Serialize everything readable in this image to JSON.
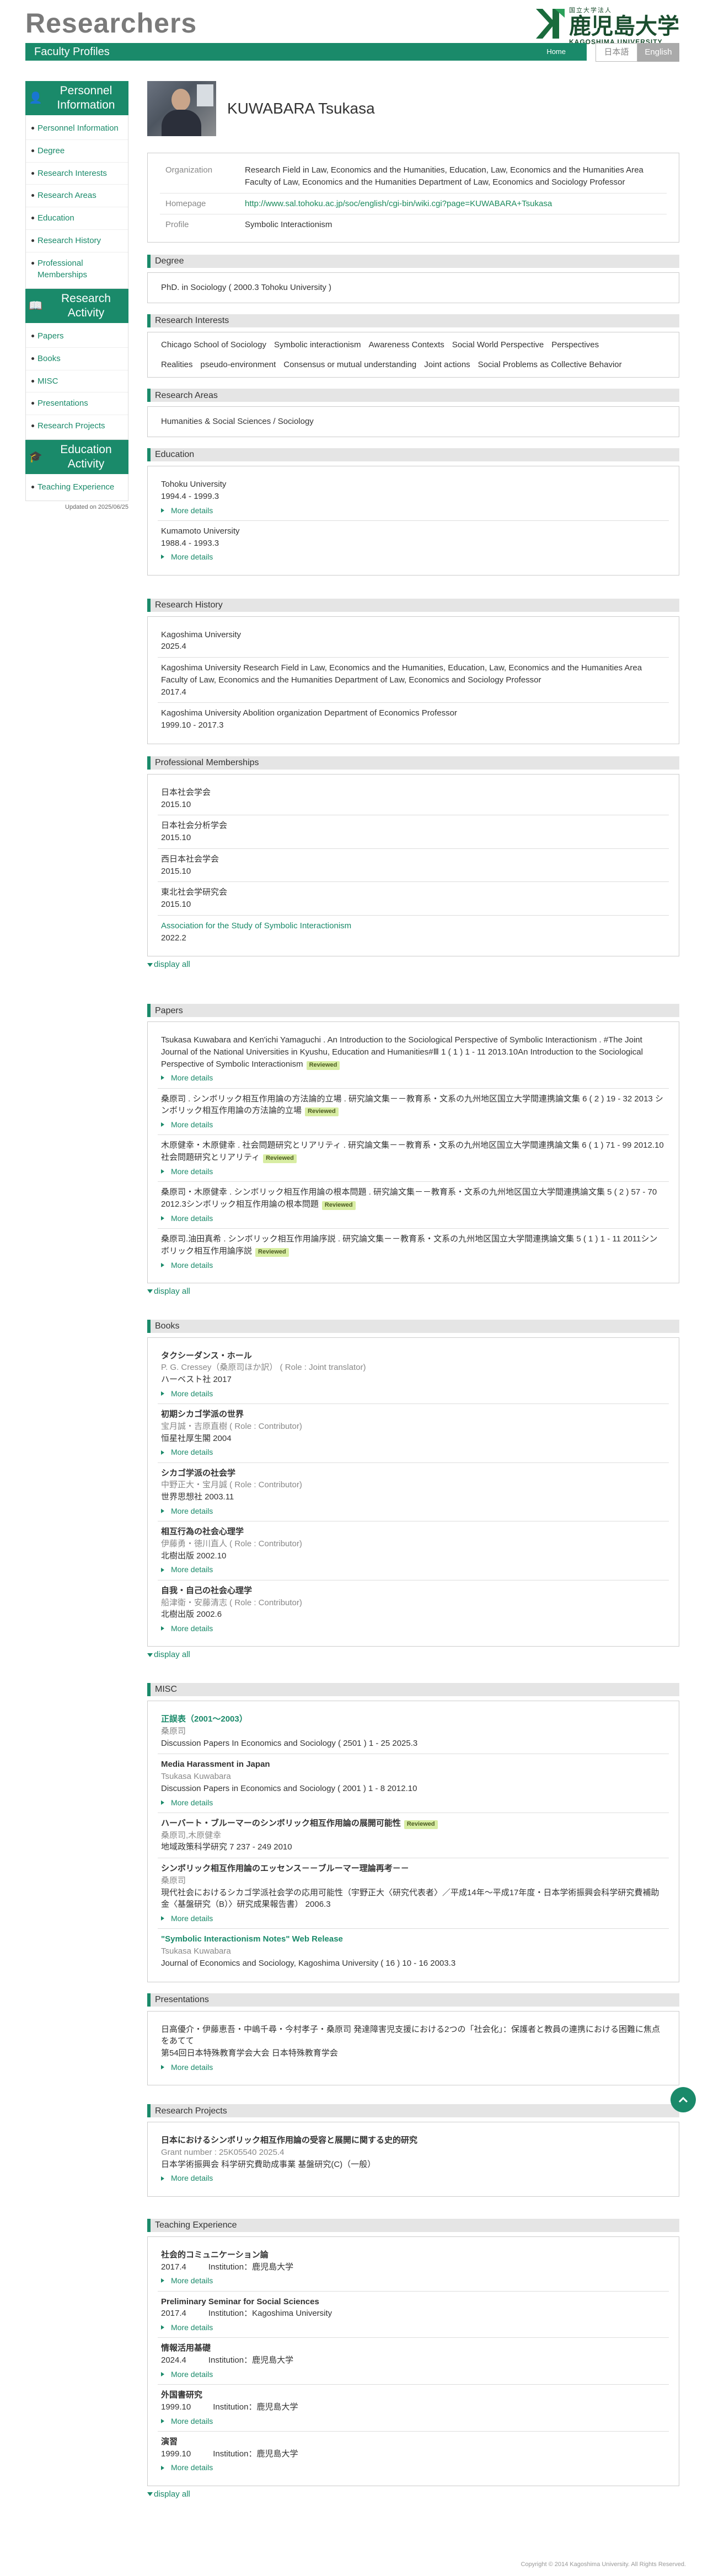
{
  "site": {
    "title": "Researchers",
    "logo_small": "国立大学法人",
    "logo_big": "鹿児島大学",
    "logo_en": "KAGOSHIMA UNIVERSITY"
  },
  "nav": {
    "page": "Faculty Profiles",
    "home": "Home",
    "lang_ja": "日本語",
    "lang_en": "English"
  },
  "sidebar": {
    "groups": [
      {
        "title": "Personnel Information",
        "items": [
          "Personnel Information",
          "Degree",
          "Research Interests",
          "Research Areas",
          "Education",
          "Research History",
          "Professional Memberships"
        ]
      },
      {
        "title": "Research Activity",
        "items": [
          "Papers",
          "Books",
          "MISC",
          "Presentations",
          "Research Projects"
        ]
      },
      {
        "title": "Education Activity",
        "items": [
          "Teaching Experience"
        ]
      }
    ],
    "updated": "Updated on 2025/06/25"
  },
  "profile": {
    "name": "KUWABARA Tsukasa",
    "organization_label": "Organization",
    "organization": "Research Field in Law, Economics and the Humanities, Education, Law, Economics and the Humanities Area Faculty of Law, Economics and the Humanities Department of Law, Economics and Sociology Professor",
    "homepage_label": "Homepage",
    "homepage": "http://www.sal.tohoku.ac.jp/soc/english/cgi-bin/wiki.cgi?page=KUWABARA+Tsukasa",
    "profile_label": "Profile",
    "profile": "Symbolic Interactionism"
  },
  "labels": {
    "more": "More details",
    "display_all": "display all",
    "reviewed": "Reviewed"
  },
  "degree": {
    "title": "Degree",
    "value": "PhD. in Sociology ( 2000.3   Tohoku University )"
  },
  "interests": {
    "title": "Research Interests",
    "items": [
      "Chicago School of Sociology",
      "Symbolic interactionism",
      "Awareness Contexts",
      "Social World Perspective",
      "Perspectives",
      "Realities",
      "pseudo-environment",
      "Consensus or mutual understanding",
      "Joint actions",
      "Social Problems as Collective Behavior"
    ]
  },
  "areas": {
    "title": "Research Areas",
    "value": "Humanities & Social Sciences / Sociology"
  },
  "education": {
    "title": "Education",
    "items": [
      {
        "school": "Tohoku University",
        "period": "1994.4  -   1999.3"
      },
      {
        "school": "Kumamoto University",
        "period": "1988.4  -   1993.3"
      }
    ]
  },
  "history": {
    "title": "Research History",
    "items": [
      {
        "line1": "Kagoshima University",
        "line2": "2025.4"
      },
      {
        "line1": "Kagoshima University   Research Field in Law, Economics and the Humanities, Education, Law, Economics and the Humanities Area Faculty of Law, Economics and the Humanities Department of Law, Economics and Sociology   Professor",
        "line2": "2017.4"
      },
      {
        "line1": "Kagoshima University   Abolition organization Department of Economics   Professor",
        "line2": "1999.10  -   2017.3"
      }
    ]
  },
  "memberships": {
    "title": "Professional Memberships",
    "items": [
      {
        "name": "日本社会学会",
        "date": "2015.10"
      },
      {
        "name": "日本社会分析学会",
        "date": "2015.10"
      },
      {
        "name": "西日本社会学会",
        "date": "2015.10"
      },
      {
        "name": "東北社会学研究会",
        "date": "2015.10"
      },
      {
        "name": "Association for the Study of Symbolic Interactionism",
        "date": "2022.2"
      }
    ]
  },
  "papers": {
    "title": "Papers",
    "items": [
      {
        "text": "Tsukasa Kuwabara and Ken'ichi Yamaguchi .  An Introduction to the Sociological Perspective of Symbolic Interactionism .  #The Joint Journal of the National Universities in Kyushu, Education and Humanities#Ⅲ 1 ( 1 ) 1 - 11   2013.10An Introduction to the Sociological Perspective of Symbolic Interactionism"
      },
      {
        "text": "桑原司 .  シンボリック相互作用論の方法論的立場 .  研究論文集－－教育系・文系の九州地区国立大学間連携論文集 6 ( 2 ) 19 - 32   2013 シンボリック相互作用論の方法論的立場"
      },
      {
        "text": "木原健幸・木原健幸 .  社会問題研究とリアリティ .  研究論文集－－教育系・文系の九州地区国立大学間連携論文集 6 ( 1 ) 71 - 99   2012.10社会問題研究とリアリティ"
      },
      {
        "text": "桑原司・木原健幸 .  シンボリック相互作用論の根本問題 .  研究論文集－－教育系・文系の九州地区国立大学間連携論文集 5 ( 2 ) 57 - 70   2012.3シンボリック相互作用論の根本問題"
      },
      {
        "text": "桑原司.油田真希 .  シンボリック相互作用論序説 .  研究論文集－－教育系・文系の九州地区国立大学間連携論文集 5 ( 1 ) 1 - 11   2011シンボリック相互作用論序説"
      }
    ]
  },
  "books": {
    "title": "Books",
    "items": [
      {
        "title": "タクシーダンス・ホール",
        "authors": "P. G. Cressey（桑原司ほか訳） ( Role :  Joint translator)",
        "pub": "ハーベスト社  2017"
      },
      {
        "title": "初期シカゴ学派の世界",
        "authors": "宝月誠・吉原直樹 ( Role :  Contributor)",
        "pub": "恒星社厚生閣  2004"
      },
      {
        "title": "シカゴ学派の社会学",
        "authors": "中野正大・宝月誠 ( Role :  Contributor)",
        "pub": "世界思想社  2003.11"
      },
      {
        "title": "相互行為の社会心理学",
        "authors": "伊藤勇・徳川直人 ( Role :  Contributor)",
        "pub": "北樹出版  2002.10"
      },
      {
        "title": "自我・自己の社会心理学",
        "authors": "船津衛・安藤清志 ( Role :  Contributor)",
        "pub": "北樹出版  2002.6"
      }
    ]
  },
  "misc": {
    "title": "MISC",
    "items": [
      {
        "title": "正誤表（2001～2003）",
        "author": "桑原司",
        "journal": "Discussion Papers In Economics and Sociology  ( 2501 )  1 - 25   2025.3",
        "green": true
      },
      {
        "title": "Media Harassment in Japan",
        "author": "Tsukasa Kuwabara",
        "journal": "Discussion Papers in Economics and Sociology  ( 2001 )   1 - 8   2012.10"
      },
      {
        "title": "ハーバート・ブルーマーのシンボリック相互作用論の展開可能性",
        "author": "桑原司,木原健幸",
        "journal": "地域政策科学研究   7   237 - 249   2010"
      },
      {
        "title": "シンボリック相互作用論のエッセンス－－ブルーマー理論再考－－",
        "author": "桑原司",
        "journal": "現代社会におけるシカゴ学派社会学の応用可能性（宇野正大〈研究代表者〉／平成14年～平成17年度・日本学術振興会科学研究費補助金〈基盤研究（B）〉研究成果報告書）   2006.3"
      },
      {
        "title": "\"Symbolic Interactionism Notes\" Web Release",
        "author": "Tsukasa Kuwabara",
        "journal": "Journal of Economics and Sociology, Kagoshima University  ( 16 )  10 - 16   2003.3",
        "green": true
      }
    ]
  },
  "presentations": {
    "title": "Presentations",
    "items": [
      {
        "line1": "日高優介・伊藤恵吾・中嶋千尋・今村孝子・桑原司   発達障害児支援における2つの「社会化」：保護者と教員の連携における困難に焦点をあてて",
        "line2": "第54回日本特殊教育学会大会  日本特殊教育学会"
      }
    ]
  },
  "projects": {
    "title": "Research Projects",
    "items": [
      {
        "title": "日本におけるシンボリック相互作用論の受容と展開に関する史的研究",
        "grant": "Grant number : 25K05540  2025.4",
        "org": "日本学術振興会  科学研究費助成事業  基盤研究(C)（一般）"
      }
    ]
  },
  "teaching": {
    "title": "Teaching Experience",
    "institution_label": "Institution：",
    "items": [
      {
        "course": "社会的コミュニケーション論",
        "date": "2017.4",
        "inst": "鹿児島大学"
      },
      {
        "course": "Preliminary Seminar for Social Sciences",
        "date": "2017.4",
        "inst": "Kagoshima University"
      },
      {
        "course": "情報活用基礎",
        "date": "2024.4",
        "inst": "鹿児島大学"
      },
      {
        "course": "外国書研究",
        "date": "1999.10",
        "inst": "鹿児島大学"
      },
      {
        "course": "演習",
        "date": "1999.10",
        "inst": "鹿児島大学"
      }
    ]
  },
  "footer": "Copyright © 2014 Kagoshima University. All Rights Reserved."
}
